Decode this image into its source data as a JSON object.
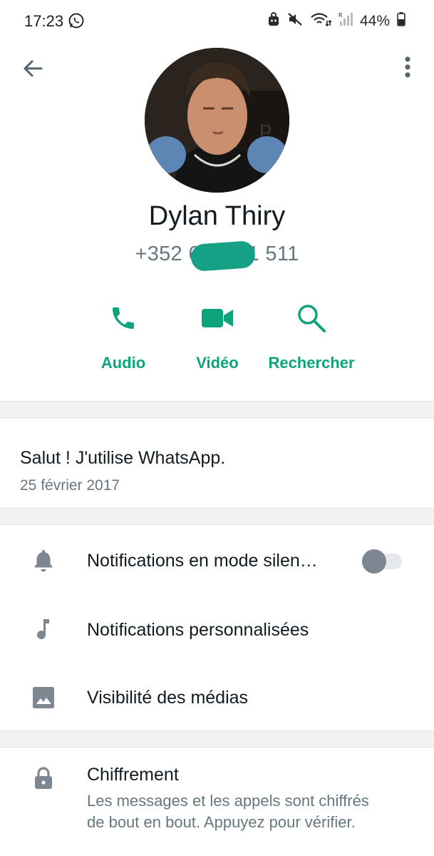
{
  "status_bar": {
    "time": "17:23",
    "battery": "44%",
    "icons": [
      "whatsapp-icon",
      "vpn-icon",
      "mute-icon",
      "wifi-icon",
      "signal-icon",
      "battery-icon"
    ]
  },
  "contact": {
    "name": "Dylan Thiry",
    "phone": "+352 6        1 511"
  },
  "actions": [
    {
      "label": "Audio",
      "icon": "phone-icon"
    },
    {
      "label": "Vidéo",
      "icon": "video-icon"
    },
    {
      "label": "Rechercher",
      "icon": "search-icon"
    }
  ],
  "about": {
    "text": "Salut ! J'utilise WhatsApp.",
    "date": "25 février 2017"
  },
  "settings": [
    {
      "label": "Notifications en mode silen…",
      "icon": "bell-icon",
      "toggle_on": false
    },
    {
      "label": "Notifications personnalisées",
      "icon": "music-note-icon"
    },
    {
      "label": "Visibilité des médias",
      "icon": "image-icon"
    }
  ],
  "encryption": {
    "title": "Chiffrement",
    "description": "Les messages et les appels sont chiffrés de bout en bout. Appuyez pour vérifier."
  },
  "colors": {
    "accent": "#0ea47b",
    "secondary_text": "#667781",
    "icon_gray": "#7d8792"
  }
}
